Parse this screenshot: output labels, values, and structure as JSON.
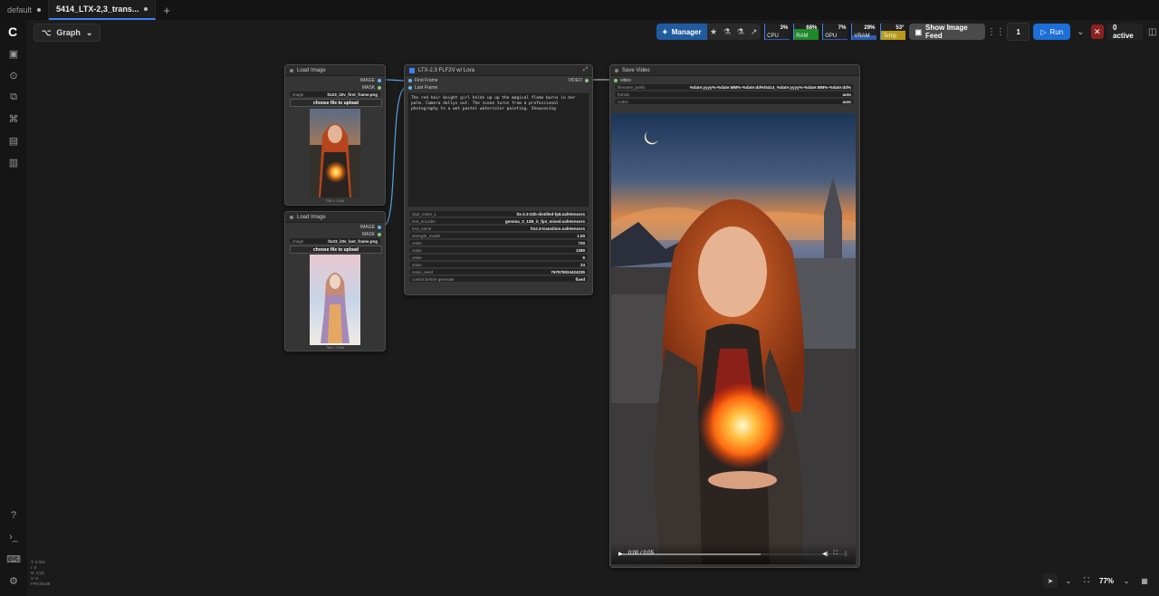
{
  "tabs": [
    {
      "label": "default",
      "modified": true
    },
    {
      "label": "5414_LTX-2,3_trans...",
      "modified": true,
      "active": true
    }
  ],
  "graph_button": {
    "label": "Graph"
  },
  "toolbar": {
    "manager_label": "Manager",
    "stats": [
      {
        "name": "CPU",
        "pct": "3%",
        "color": "#2b5cb0",
        "fill": 0.03
      },
      {
        "name": "RAM",
        "pct": "68%",
        "color": "#1f8a2a",
        "fill": 0.68
      },
      {
        "name": "GPU",
        "pct": "7%",
        "color": "#2b5cb0",
        "fill": 0.07
      },
      {
        "name": "VRAM",
        "pct": "29%",
        "color": "#2b5cb0",
        "fill": 0.29
      },
      {
        "name": "Temp",
        "pct": "53°",
        "color": "#b89b1a",
        "fill": 0.53
      }
    ],
    "feed_label": "Show Image Feed",
    "batch_count": "1",
    "run_label": "Run",
    "active_label": "0 active"
  },
  "nodes": {
    "load_image_1": {
      "title": "Load Image",
      "outputs": [
        "IMAGE",
        "MASK"
      ],
      "widget_label": "image",
      "widget_value": "ltx23_i2Iv_first_frame.png",
      "upload_label": "choose file to upload",
      "caption": "768 × 1344"
    },
    "load_image_2": {
      "title": "Load Image",
      "outputs": [
        "IMAGE",
        "MASK"
      ],
      "widget_label": "image",
      "widget_value": "ltx23_i2Iv_last_frame.png",
      "upload_label": "choose file to upload",
      "caption": "768 × 1344"
    },
    "ltx": {
      "title": "LTX-2.3 FLF2V w/ Lora",
      "inputs": [
        "First Frame",
        "Last Frame"
      ],
      "output": "VIDEO",
      "prompt": "The red hair knight girl holds up up the magical flame burns in her palm. Camera dollys out. The scene turns from a professional photography to a wet pastel watercolor painting. Showcasing",
      "widgets": [
        {
          "label": "ckpt_name_1",
          "value": "ltx-2.3-22b-distilled-fp8.safetensors"
        },
        {
          "label": "text_encoder",
          "value": "gemma_3_12B_it_fp4_mixed.safetensors"
        },
        {
          "label": "lora_name",
          "value": "ltx2.3-transition.safetensors"
        },
        {
          "label": "strength_model",
          "value": "1.00"
        },
        {
          "label": "value",
          "value": "720"
        },
        {
          "label": "value",
          "value": "1280"
        },
        {
          "label": "value",
          "value": "6"
        },
        {
          "label": "value",
          "value": "24"
        },
        {
          "label": "noise_seed",
          "value": "767979024424235"
        },
        {
          "label": "control before generate",
          "value": "fixed"
        }
      ]
    },
    "save_video": {
      "title": "Save Video",
      "input": "video",
      "widgets": [
        {
          "label": "filename_prefix",
          "value": "%date:yyyy%-%date:MM%-%date:dd%/5414_%date:yyyy%-%date:MM%-%date:dd%"
        },
        {
          "label": "format",
          "value": "auto"
        },
        {
          "label": "codec",
          "value": "auto"
        }
      ],
      "time": "0:00 / 0:05"
    }
  },
  "stats_overlay": [
    "T: 0.00s",
    "I: 0",
    "N: 4 [4]",
    "V: 8",
    "FPS:59.88"
  ],
  "zoom": "77%"
}
